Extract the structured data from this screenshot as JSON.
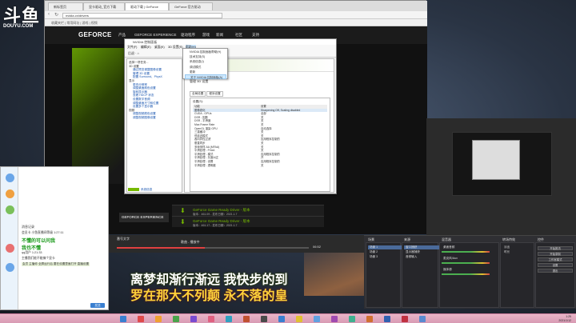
{
  "watermark": {
    "logo": "斗鱼",
    "sub": "DOUYU.COM"
  },
  "browser": {
    "tabs": [
      "新标签页",
      "驱动下载 | GeForce",
      "显卡驱动_官方下载",
      "GeForce 官方驱动"
    ],
    "url": "nvidia.cn/drivers",
    "bookmarks": "收藏夹栏  |  常用网址  |  游戏  |  视频"
  },
  "nvidia": {
    "logo": "GEFORCE",
    "nav": [
      "产品",
      "GEFORCE EXPERIENCE",
      "驱动程序",
      "游戏",
      "新闻",
      "社区",
      "支持"
    ],
    "gfexp_label": "GEFORCE EXPERIENCE",
    "drivers": [
      {
        "title": "GeForce Game Ready Driver - 版本",
        "sub": "版本：461.09 - 发布日期：2021.1.7"
      },
      {
        "title": "GeForce Game Ready Driver - 版本",
        "sub": "版本：461.17 - 发布日期：2021.1.7"
      },
      {
        "title": "GeForce Game Ready Driver - 版本",
        "sub": "版本：460.89 - 发布日期：2020.12.15"
      }
    ]
  },
  "control_panel": {
    "title": "NVIDIA 控制面板",
    "menu": [
      "文件(F)",
      "编辑(E)",
      "桌面(K)",
      "3D 设置(S)",
      "帮助(H)"
    ],
    "toolbar": "后退  ·  ⌂",
    "tree_head": "选择一项任务...",
    "tree": [
      "3D 设置",
      "通过预览调整图像设置",
      "管理 3D 设置",
      "配置 Surround、PhysX",
      "显示",
      "更改分辨率",
      "调整桌面颜色设置",
      "旋转显示器",
      "查看 HDCP 状态",
      "设置数字音频",
      "调整桌面尺寸和位置",
      "设置多个显示器",
      "视频",
      "调整视频颜色设置",
      "调整视频图像设置"
    ],
    "heading": "管理 3D 设置",
    "tabs": [
      "全局设置",
      "程序设置"
    ],
    "settings_label": "设置(S):",
    "table_header": [
      "功能",
      "设置"
    ],
    "rows": [
      [
        "图像锐化",
        "Sharpening Off, Scaling disabled"
      ],
      [
        "CUDA - GPUs",
        "全部"
      ],
      [
        "DSR - 因数",
        "关"
      ],
      [
        "DSR - 平滑度",
        "关"
      ],
      [
        "Max Frame Rate",
        "关"
      ],
      [
        "OpenGL 渲染 GPU",
        "自动选择"
      ],
      [
        "三重缓冲",
        "关"
      ],
      [
        "低延迟模式",
        "关"
      ],
      [
        "各向异性过滤",
        "应用程序控制的"
      ],
      [
        "垂直同步",
        "关"
      ],
      [
        "多帧采样 AA (MFAA)",
        "关"
      ],
      [
        "平滑处理 - FXAA",
        "关"
      ],
      [
        "平滑处理 - 模式",
        "应用程序控制的"
      ],
      [
        "平滑处理 - 灰度纠正",
        "开"
      ],
      [
        "平滑处理 - 设置",
        "应用程序控制的"
      ],
      [
        "平滑处理 - 透明度",
        "关"
      ]
    ],
    "bottom_link": "系统信息"
  },
  "help_menu": {
    "items": [
      "NVIDIA 控制面板帮助(H)",
      "技术支持(S)",
      "系统信息(I)",
      "调试模式",
      "更新",
      "关于 NVIDIA 控制面板(A)"
    ],
    "highlighted_index": 5
  },
  "chat": {
    "header": "消息记录",
    "lines": [
      {
        "kind": "meta",
        "text": "会员卡 小鱼直播间等级 1:27:11"
      },
      {
        "kind": "big",
        "text": "不懂的可以问我"
      },
      {
        "kind": "big",
        "text": "我也不懂"
      },
      {
        "kind": "meta",
        "text": "qq用户 1:21:33"
      },
      {
        "kind": "meta",
        "text": "主播我们能不能搞个显卡"
      },
      {
        "kind": "hl",
        "text": "会员 主播你 全屏运行后 要在设置里面打开 直播设置"
      }
    ],
    "send": "发送"
  },
  "player": {
    "left_label": "番号文字",
    "title": "歌曲 - 播放中",
    "time": "06:52",
    "progress": 0.46
  },
  "obs": {
    "panels": [
      {
        "title": "场景",
        "rows": [
          "场景 1",
          "场景 2",
          "场景 3"
        ],
        "selected": 0
      },
      {
        "title": "来源",
        "rows": [
          "窗口捕获",
          "显示器捕获",
          "音频输入"
        ],
        "selected": 0
      },
      {
        "title": "混音器",
        "rows": [
          "桌面音频",
          "麦克风/Aux",
          "媒体源"
        ],
        "selected": -1
      },
      {
        "title": "转场特效",
        "rows": [
          "淡出",
          "时长"
        ],
        "selected": -1
      },
      {
        "title": "控件",
        "rows": [
          "开始推流",
          "开始录制",
          "工作室模式",
          "设置",
          "退出"
        ],
        "selected": -1
      }
    ]
  },
  "lyrics": {
    "line1": "离梦却渐行渐远  我快步的到",
    "line2": "罗在那大不列颠  永不落的皇"
  },
  "taskbar": {
    "time": "1:25",
    "date": "2021/1/12"
  }
}
